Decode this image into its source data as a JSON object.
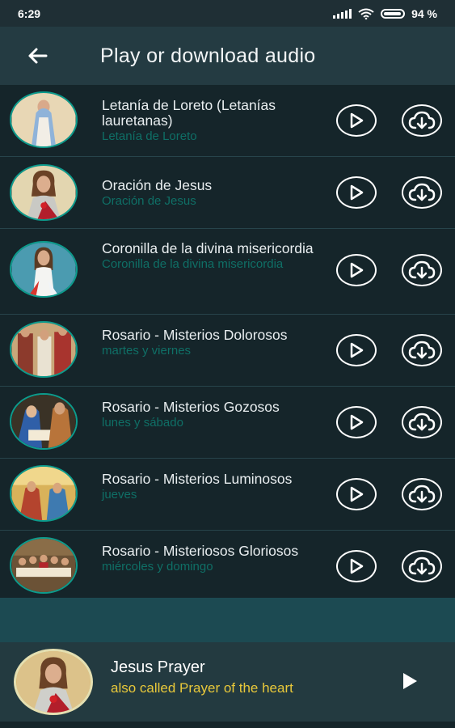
{
  "status_bar": {
    "time": "6:29",
    "battery": "94 %"
  },
  "app_bar": {
    "title": "Play or download audio",
    "back_icon": "arrow-left-icon"
  },
  "items": [
    {
      "title": "Letanía de Loreto (Letanías lauretanas)",
      "subtitle": "Letanía de Loreto",
      "image": "mary-image"
    },
    {
      "title": "Oración de Jesus",
      "subtitle": "Oración de Jesus",
      "image": "sacred-heart-image"
    },
    {
      "title": "Coronilla de la divina misericordia",
      "subtitle": "Coronilla de la divina misericordia",
      "image": "divine-mercy-image"
    },
    {
      "title": "Rosario - Misterios Dolorosos",
      "subtitle": "martes y viernes",
      "image": "sorrowful-mysteries-image"
    },
    {
      "title": "Rosario - Misterios Gozosos",
      "subtitle": "lunes y sábado",
      "image": "joyful-mysteries-image"
    },
    {
      "title": "Rosario - Misterios Luminosos",
      "subtitle": "jueves",
      "image": "luminous-mysteries-image"
    },
    {
      "title": "Rosario - Misteriosos Gloriosos",
      "subtitle": "miércoles y domingo",
      "image": "glorious-mysteries-image"
    }
  ],
  "now_playing": {
    "title": "Jesus Prayer",
    "subtitle": "also called Prayer of the heart",
    "image": "sacred-heart-image"
  },
  "colors": {
    "accent_teal": "#0c9c8d",
    "subtitle_green": "#0f6f66",
    "now_playing_subtitle": "#e8c83a"
  },
  "icons": {
    "play": "play-circle-icon",
    "download": "cloud-download-icon"
  }
}
